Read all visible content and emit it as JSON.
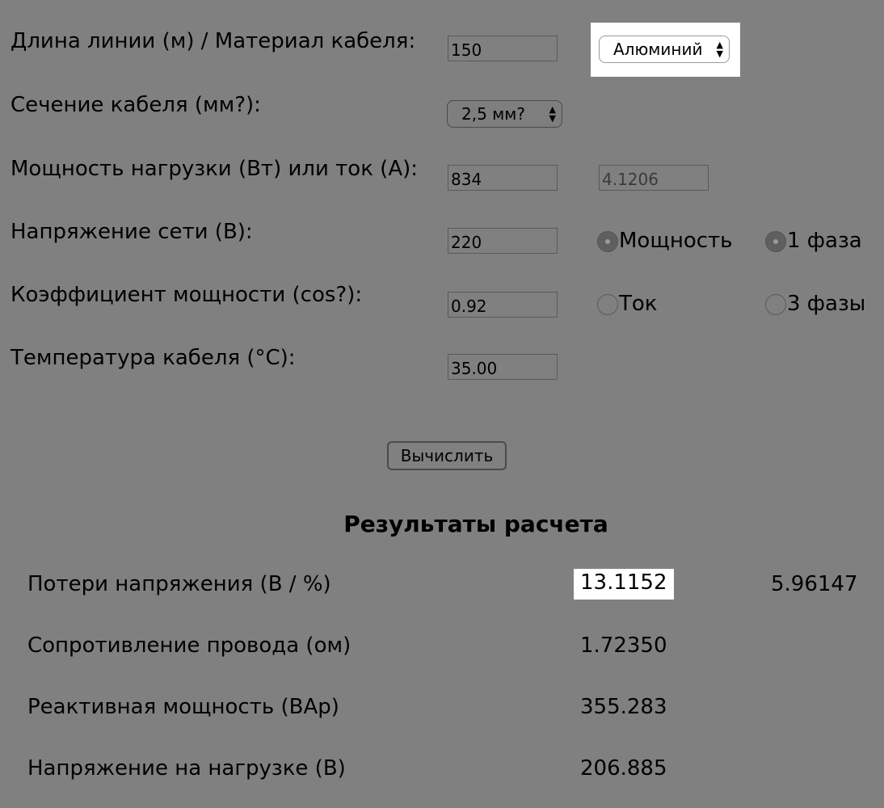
{
  "form": {
    "length_material_label": "Длина линии (м) / Материал кабеля:",
    "length_value": "150",
    "material_selected": "Алюминий",
    "section_label": "Сечение кабеля (мм?):",
    "section_selected": "2,5 мм?",
    "power_current_label": "Мощность нагрузки (Вт) или ток (А):",
    "power_value": "834",
    "current_value": "4.1206",
    "voltage_label": "Напряжение сети (В):",
    "voltage_value": "220",
    "power_factor_label": "Коэффициент мощности (cos?):",
    "power_factor_value": "0.92",
    "temperature_label": "Температура кабеля (°C):",
    "temperature_value": "35.00",
    "mode_radio": {
      "power_label": "Мощность",
      "current_label": "Ток",
      "selected": "Мощность"
    },
    "phase_radio": {
      "one_phase_label": "1 фаза",
      "three_phase_label": "3 фазы",
      "selected": "1 фаза"
    },
    "calculate_button_label": "Вычислить"
  },
  "results": {
    "title": "Результаты расчета",
    "voltage_loss_label": "Потери напряжения (В / %)",
    "voltage_loss_value": "13.1152",
    "voltage_loss_percent": "5.96147",
    "resistance_label": "Сопротивление провода (ом)",
    "resistance_value": "1.72350",
    "reactive_power_label": "Реактивная мощность (ВАр)",
    "reactive_power_value": "355.283",
    "load_voltage_label": "Напряжение на нагрузке (В)",
    "load_voltage_value": "206.885"
  },
  "colors": {
    "background": "#808080",
    "highlight": "#ffffff"
  }
}
